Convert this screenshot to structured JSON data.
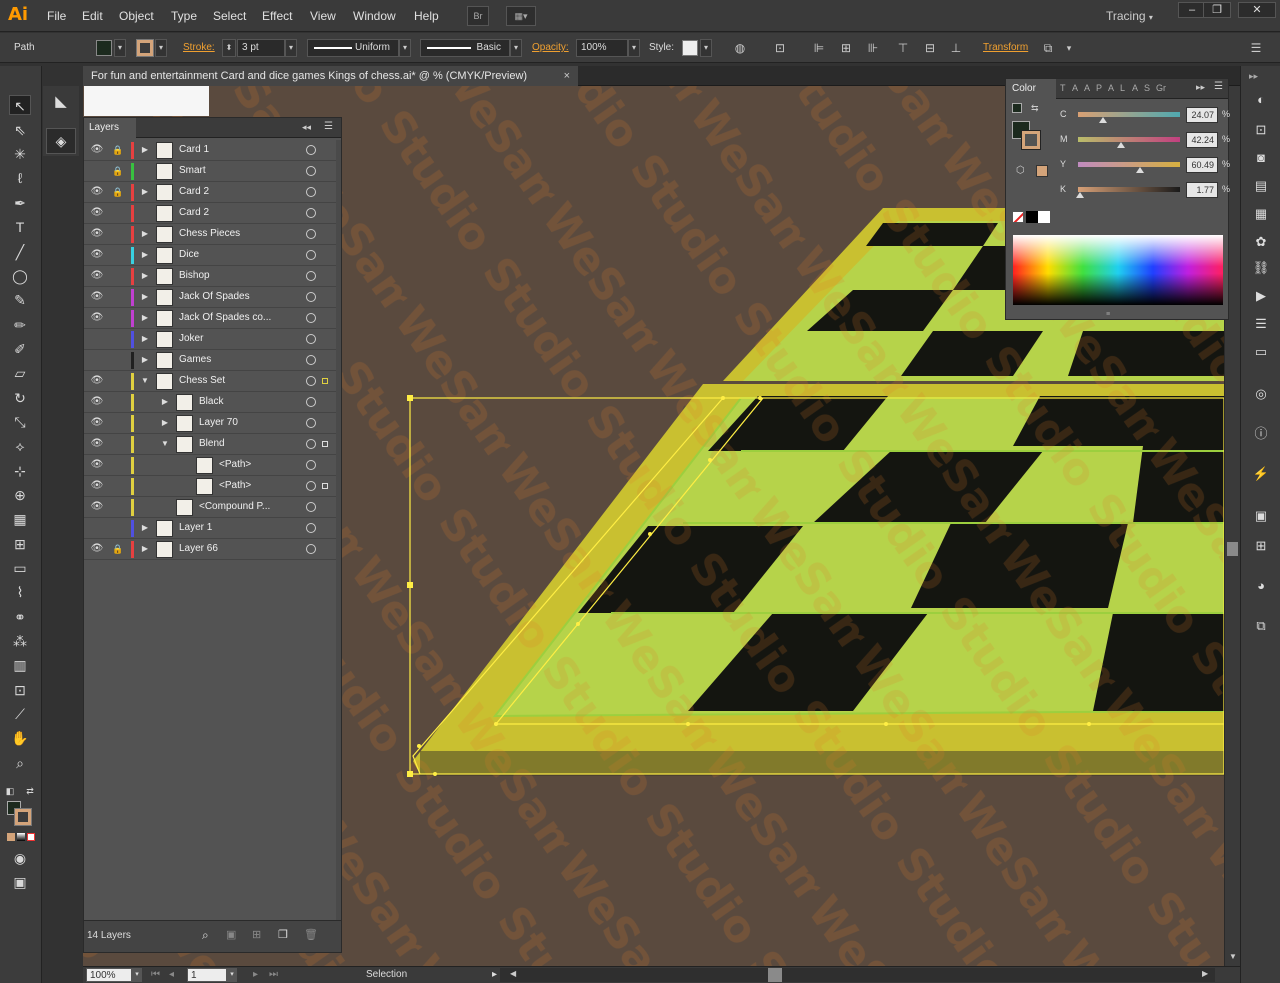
{
  "app": {
    "logo": "Ai",
    "workspace": "Tracing"
  },
  "menu": [
    "File",
    "Edit",
    "Object",
    "Type",
    "Select",
    "Effect",
    "View",
    "Window",
    "Help"
  ],
  "menu_buttons": {
    "bridge": "Br"
  },
  "control": {
    "selection_type": "Path",
    "stroke_label": "Stroke:",
    "stroke_value": "3 pt",
    "profile": "Uniform",
    "brush": "Basic",
    "opacity_label": "Opacity:",
    "opacity_value": "100%",
    "style_label": "Style:",
    "transform_label": "Transform"
  },
  "document": {
    "title": "For fun and entertainment Card and dice games Kings of chess.ai* @ % (CMYK/Preview)"
  },
  "layers": {
    "tab": "Layers",
    "count_label": "14 Layers",
    "rows": [
      {
        "name": "Card 1",
        "color": "#e64040",
        "visible": true,
        "locked": true,
        "expand": "right",
        "depth": 0
      },
      {
        "name": "Smart",
        "color": "#38c040",
        "visible": false,
        "locked": true,
        "expand": "none",
        "depth": 0
      },
      {
        "name": "Card 2",
        "color": "#e64040",
        "visible": true,
        "locked": true,
        "expand": "right",
        "depth": 0
      },
      {
        "name": "Card 2",
        "color": "#e64040",
        "visible": true,
        "locked": false,
        "expand": "none",
        "depth": 0
      },
      {
        "name": "Chess Pieces",
        "color": "#e64040",
        "visible": true,
        "locked": false,
        "expand": "right",
        "depth": 0
      },
      {
        "name": "Dice",
        "color": "#38d0e0",
        "visible": true,
        "locked": false,
        "expand": "right",
        "depth": 0
      },
      {
        "name": "Bishop",
        "color": "#e64040",
        "visible": true,
        "locked": false,
        "expand": "right",
        "depth": 0
      },
      {
        "name": "Jack Of Spades",
        "color": "#c040d0",
        "visible": true,
        "locked": false,
        "expand": "right",
        "depth": 0
      },
      {
        "name": "Jack Of Spades co...",
        "color": "#c040d0",
        "visible": true,
        "locked": false,
        "expand": "right",
        "depth": 0
      },
      {
        "name": "Joker",
        "color": "#5050e0",
        "visible": false,
        "locked": false,
        "expand": "right",
        "depth": 0
      },
      {
        "name": "Games",
        "color": "#202020",
        "visible": false,
        "locked": false,
        "expand": "right",
        "depth": 0
      },
      {
        "name": "Chess Set",
        "color": "#e0d040",
        "visible": true,
        "locked": false,
        "expand": "down",
        "depth": 0
      },
      {
        "name": "Black",
        "color": "#e0d040",
        "visible": true,
        "locked": false,
        "expand": "right",
        "depth": 1
      },
      {
        "name": "Layer 70",
        "color": "#e0d040",
        "visible": true,
        "locked": false,
        "expand": "right",
        "depth": 1
      },
      {
        "name": "Blend",
        "color": "#e0d040",
        "visible": true,
        "locked": false,
        "expand": "down",
        "depth": 1
      },
      {
        "name": "<Path>",
        "color": "#e0d040",
        "visible": true,
        "locked": false,
        "expand": "none",
        "depth": 2
      },
      {
        "name": "<Path>",
        "color": "#e0d040",
        "visible": true,
        "locked": false,
        "expand": "none",
        "depth": 2
      },
      {
        "name": "<Compound P...",
        "color": "#e0d040",
        "visible": true,
        "locked": false,
        "expand": "none",
        "depth": 1
      },
      {
        "name": "Layer 1",
        "color": "#5050e0",
        "visible": false,
        "locked": false,
        "expand": "right",
        "depth": 0
      },
      {
        "name": "Layer 66",
        "color": "#e64040",
        "visible": true,
        "locked": true,
        "expand": "right",
        "depth": 0
      }
    ]
  },
  "color_panel": {
    "tab": "Color",
    "other_tabs": [
      "T",
      "A",
      "A",
      "P",
      "A",
      "L",
      "A",
      "S",
      "Gr"
    ],
    "channels": [
      {
        "label": "C",
        "value": "24.07",
        "fraction": 0.2407,
        "gradient": "linear-gradient(to right,#d9a073,#4fa9b0)"
      },
      {
        "label": "M",
        "value": "42.24",
        "fraction": 0.4224,
        "gradient": "linear-gradient(to right,#b9bd6a,#c24080)"
      },
      {
        "label": "Y",
        "value": "60.49",
        "fraction": 0.6049,
        "gradient": "linear-gradient(to right,#c08bc0,#d6b040)"
      },
      {
        "label": "K",
        "value": "1.77",
        "fraction": 0.0177,
        "gradient": "linear-gradient(to right,#d7a077,#1a1a1a)"
      }
    ],
    "percent": "%"
  },
  "status": {
    "zoom": "100%",
    "artboard": "1",
    "tool": "Selection"
  },
  "colors": {
    "board_frame": "#c9c030",
    "board_light": "#b6d34a",
    "board_dark": "#141510",
    "canvas_bg": "#5a4a3e",
    "selection": "#ffee44",
    "accent_orange": "#f0a030"
  }
}
